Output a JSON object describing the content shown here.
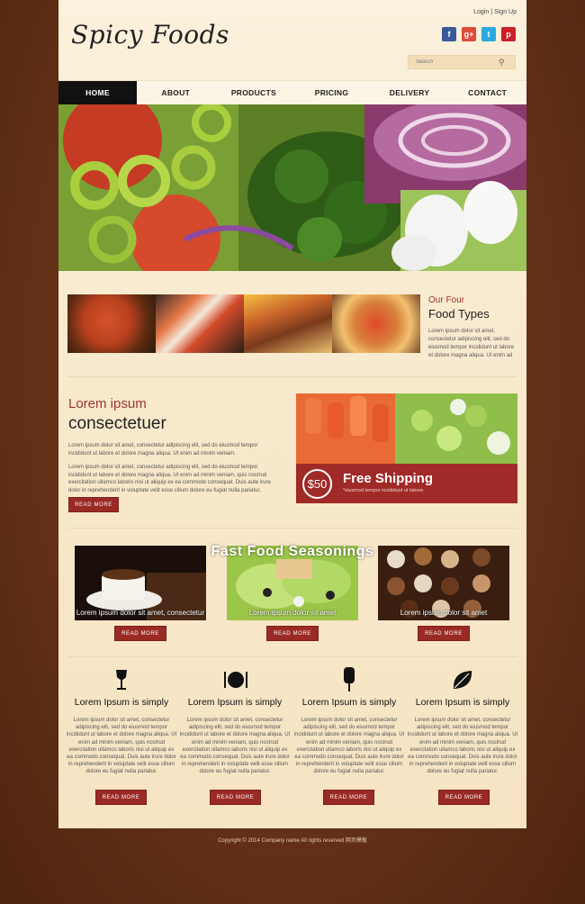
{
  "header": {
    "logo_text": "Spicy Foods",
    "login_label": "Login",
    "separator": "|",
    "signup_label": "Sign Up",
    "search_placeholder": "Search",
    "social": [
      "facebook-icon",
      "google-plus-icon",
      "twitter-icon",
      "pinterest-icon"
    ]
  },
  "nav": {
    "items": [
      "HOME",
      "ABOUT",
      "PRODUCTS",
      "PRICING",
      "DELIVERY",
      "CONTACT"
    ],
    "active": "HOME"
  },
  "food_types": {
    "title_small": "Our Four",
    "title_large": "Food Types",
    "text": "Lorem ipsum dolor sit amet, consectetur adipiscing elit, sed do eiusmod tempor incididunt ut labore et dolore magna aliqua. Ut enim ad"
  },
  "lorem": {
    "title1": "Lorem ipsum",
    "title2": "consectetuer",
    "para1": "Lorem ipsum dolor sit amet, consectetur adipiscing elit, sed do eiusmod tempor incididunt ut labore et dolore magna aliqua. Ut enim ad minim veniam.",
    "para2": "Lorem ipsum dolor sit amet, consectetur adipiscing elit, sed do eiusmod tempor incididunt ut labore et dolore magna aliqua. Ut enim ad minim veniam, quis nostrud exercitation ullamco laboris nisi ut aliquip ex ea commodo consequat. Duis aute irure dolor in reprehenderit in voluptate velit esse cillum dolore eu fugiat nulla pariatur.",
    "button": "READ MORE"
  },
  "shipping": {
    "price": "$50",
    "title": "Free Shipping",
    "subtitle": "*eiusmod tempor incididunt ut labore"
  },
  "seasonings": {
    "title": "Fast Food Seasonings",
    "captions": [
      "Lorem ipsum dolor sit amet, consectetur",
      "Lorem ipsum dolor sit amet",
      "Lorem ipsum dolor sit amet"
    ],
    "button": "READ MORE"
  },
  "columns": {
    "title": "Lorem Ipsum is simply",
    "text": "Lorem ipsum dolor sit amet, consectetur adipiscing elit, sed do eiusmod tempor incididunt ut labore et dolore magna aliqua. Ut enim ad minim veniam, quis nostrud exercitation ullamco laboris nisi ut aliquip ex ea commodo consequat. Duis aute irure dolor in reprehenderit in voluptate velit esse cillum dolore eu fugiat nulla pariatur.",
    "icons": [
      "wine-glass-icon",
      "plate-cutlery-icon",
      "ice-cream-icon",
      "leaf-icon"
    ],
    "button": "READ MORE"
  },
  "footer": {
    "text": "Copyright © 2014 Company name All rights reserved 网页模板"
  },
  "colors": {
    "accent": "#a02a28",
    "background": "#6a3518",
    "page": "#fbf1dc"
  }
}
